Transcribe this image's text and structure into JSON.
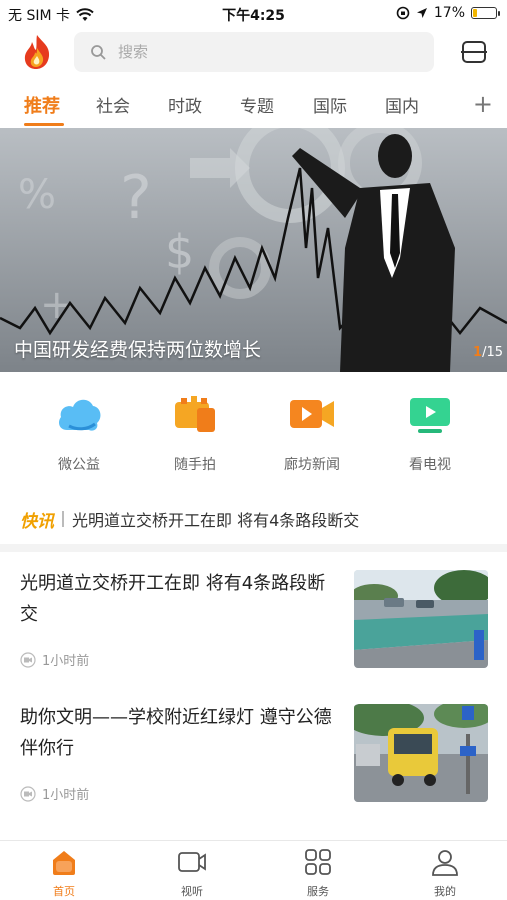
{
  "status_bar": {
    "carrier": "无 SIM 卡",
    "time": "下午4:25",
    "battery": "17%",
    "battery_level": 0.17
  },
  "header": {
    "search_placeholder": "搜索",
    "logo_icon": "flame-logo-icon",
    "menu_icon": "menu-icon"
  },
  "tabs": [
    {
      "label": "推荐",
      "active": true
    },
    {
      "label": "社会"
    },
    {
      "label": "时政"
    },
    {
      "label": "专题"
    },
    {
      "label": "国际"
    },
    {
      "label": "国内"
    }
  ],
  "tab_add_label": "+",
  "banner": {
    "caption": "中国研发经费保持两位数增长",
    "page_current": "1",
    "page_total": "/15"
  },
  "quick_entries": [
    {
      "label": "微公益",
      "icon": "cloud-icon",
      "color": "#3aa8f0"
    },
    {
      "label": "随手拍",
      "icon": "camera-icon",
      "color": "#f59a23"
    },
    {
      "label": "廊坊新闻",
      "icon": "video-icon",
      "color": "#f5861f"
    },
    {
      "label": "看电视",
      "icon": "tv-icon",
      "color": "#2ecf8a"
    }
  ],
  "flash": {
    "tag": "快讯",
    "text": "光明道立交桥开工在即 将有4条路段断交"
  },
  "news": [
    {
      "title": "光明道立交桥开工在即 将有4条路段断交",
      "time": "1小时前"
    },
    {
      "title": "助你文明——学校附近红绿灯 遵守公德伴你行",
      "time": "1小时前"
    }
  ],
  "bottom_nav": [
    {
      "label": "首页",
      "icon": "home-icon",
      "active": true
    },
    {
      "label": "视听",
      "icon": "video-camera-icon"
    },
    {
      "label": "服务",
      "icon": "grid-icon"
    },
    {
      "label": "我的",
      "icon": "user-icon"
    }
  ],
  "accent_color": "#f07d1a"
}
